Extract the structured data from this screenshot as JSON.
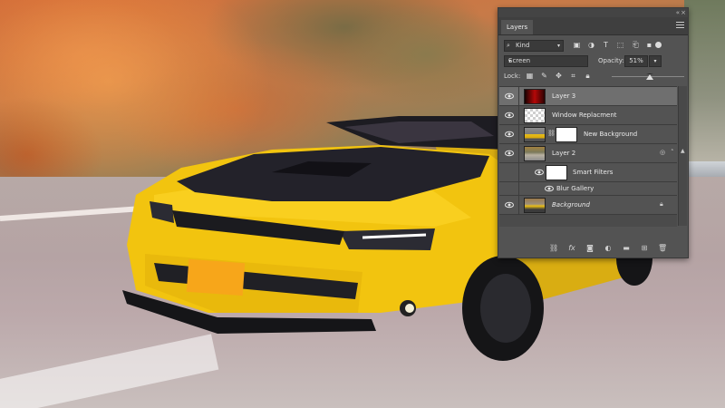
{
  "panel": {
    "title": "Layers",
    "collapse_glyph": "«",
    "close_glyph": "×",
    "filter": {
      "kind_label": "Kind",
      "search_icon": "search-icon",
      "filter_switch": "filter-toggle"
    },
    "blend_mode": "Screen",
    "opacity_label": "Opacity:",
    "opacity_value": "51%",
    "opacity_fraction": 0.51,
    "lock_label": "Lock:",
    "layers": [
      {
        "name": "Layer 3",
        "selected": true,
        "visible": true,
        "thumb": "red-gradient"
      },
      {
        "name": "Window Replacment",
        "selected": false,
        "visible": true,
        "thumb": "transparent"
      },
      {
        "name": "New Background",
        "selected": false,
        "visible": true,
        "thumb": "car-with-mask"
      },
      {
        "name": "Layer 2",
        "selected": false,
        "visible": true,
        "thumb": "landscape",
        "smart_object": true
      },
      {
        "name": "Smart Filters",
        "selected": false,
        "visible": true,
        "thumb": "white-mask",
        "sub": true
      },
      {
        "name": "Blur Gallery",
        "selected": false,
        "visible": true,
        "sub": true
      },
      {
        "name": "Background",
        "selected": false,
        "visible": true,
        "thumb": "car",
        "locked": true,
        "italic": true
      }
    ],
    "bottom_icons": [
      "link-icon",
      "fx-icon",
      "mask-icon",
      "adjustment-icon",
      "folder-icon",
      "new-layer-icon",
      "trash-icon"
    ],
    "bottom_fx_label": "fx"
  },
  "colors": {
    "panel_bg": "#535353",
    "selected_row": "#6f6f6f",
    "car_yellow": "#f2c40f",
    "hood_black": "#23222a"
  }
}
